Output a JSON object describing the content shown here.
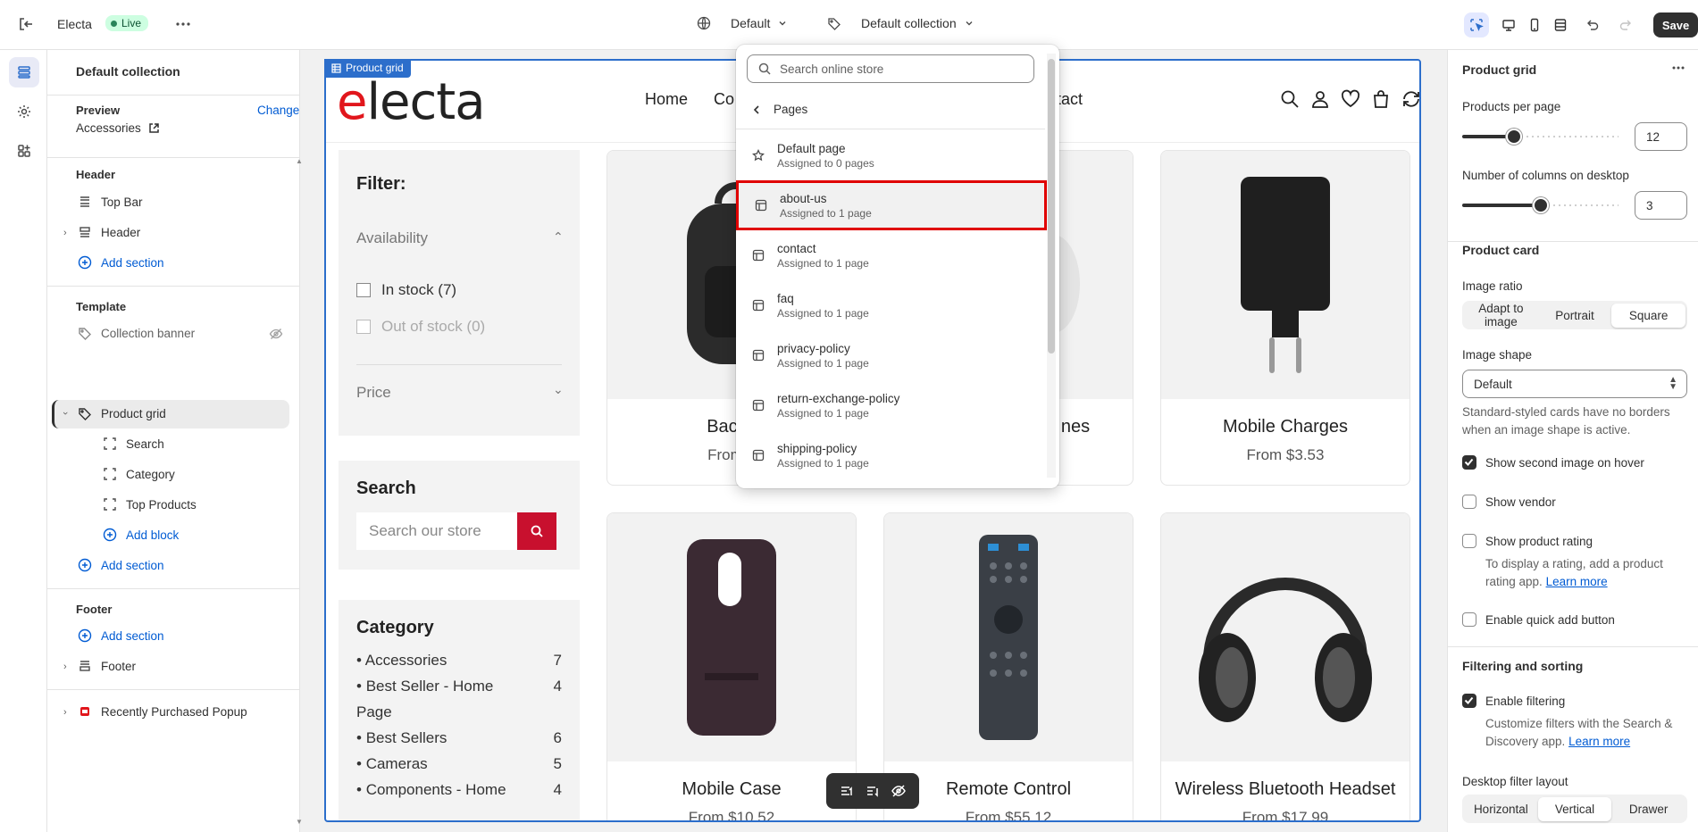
{
  "topbar": {
    "app_name": "Electa",
    "status": "Live",
    "locale": "Default",
    "template": "Default collection",
    "save_label": "Save"
  },
  "sidebar": {
    "title": "Default collection",
    "preview_label": "Preview",
    "change_label": "Change",
    "preview_value": "Accessories",
    "header_group": "Header",
    "header_items": [
      "Top Bar",
      "Header"
    ],
    "add_section": "Add section",
    "template_group": "Template",
    "template_items": [
      "Collection banner",
      "Product grid"
    ],
    "blocks": [
      "Search",
      "Category",
      "Top Products"
    ],
    "add_block": "Add block",
    "footer_group": "Footer",
    "footer_item": "Footer",
    "popup_item": "Recently Purchased Popup"
  },
  "canvas": {
    "tag": "Product grid",
    "logo_rest": "lecta",
    "logo_e": "e",
    "nav": [
      "Home",
      "Co",
      "ntact"
    ],
    "filter_title": "Filter:",
    "availability": "Availability",
    "in_stock": "In stock (7)",
    "out_of_stock": "Out of stock (0)",
    "price": "Price",
    "search_title": "Search",
    "search_placeholder": "Search our store",
    "category_title": "Category",
    "categories": [
      {
        "name": "Accessories",
        "count": "7"
      },
      {
        "name": "Best Seller - Home Page",
        "count": "4"
      },
      {
        "name": "Best Sellers",
        "count": "6"
      },
      {
        "name": "Cameras",
        "count": "5"
      },
      {
        "name": "Components - Home",
        "count": "4"
      }
    ],
    "products": [
      {
        "name": "Backp",
        "price": "From $"
      },
      {
        "name": "nes",
        "price": ""
      },
      {
        "name": "Mobile Charges",
        "price": "From $3.53"
      },
      {
        "name": "Mobile Case",
        "price": "From $10.52"
      },
      {
        "name": "Remote Control",
        "price": "From $55.12"
      },
      {
        "name": "Wireless Bluetooth Headset",
        "price": "From $17.99"
      }
    ]
  },
  "popover": {
    "search_placeholder": "Search online store",
    "back_label": "Pages",
    "items": [
      {
        "name": "Default page",
        "sub": "Assigned to 0 pages"
      },
      {
        "name": "about-us",
        "sub": "Assigned to 1 page"
      },
      {
        "name": "contact",
        "sub": "Assigned to 1 page"
      },
      {
        "name": "faq",
        "sub": "Assigned to 1 page"
      },
      {
        "name": "privacy-policy",
        "sub": "Assigned to 1 page"
      },
      {
        "name": "return-exchange-policy",
        "sub": "Assigned to 1 page"
      },
      {
        "name": "shipping-policy",
        "sub": "Assigned to 1 page"
      }
    ]
  },
  "settings": {
    "title": "Product grid",
    "products_per_page_label": "Products per page",
    "products_per_page": "12",
    "products_per_page_level": 0.33,
    "columns_label": "Number of columns on desktop",
    "columns": "3",
    "columns_level": 0.5,
    "card_title": "Product card",
    "image_ratio_label": "Image ratio",
    "image_ratio_options": [
      "Adapt to image",
      "Portrait",
      "Square"
    ],
    "image_shape_label": "Image shape",
    "image_shape_value": "Default",
    "image_shape_hint": "Standard-styled cards have no borders when an image shape is active.",
    "show_second_image": "Show second image on hover",
    "show_vendor": "Show vendor",
    "show_rating": "Show product rating",
    "rating_hint": "To display a rating, add a product rating app.",
    "learn_more": "Learn more",
    "quick_add": "Enable quick add button",
    "filter_title": "Filtering and sorting",
    "enable_filtering": "Enable filtering",
    "filtering_hint": "Customize filters with the Search & Discovery app.",
    "desktop_filter_label": "Desktop filter layout",
    "desktop_filter_options": [
      "Horizontal",
      "Vertical",
      "Drawer"
    ]
  },
  "colors": {
    "accent": "#2c6ecb",
    "brand_red": "#e1161c",
    "live_bg": "#cdfee1"
  }
}
